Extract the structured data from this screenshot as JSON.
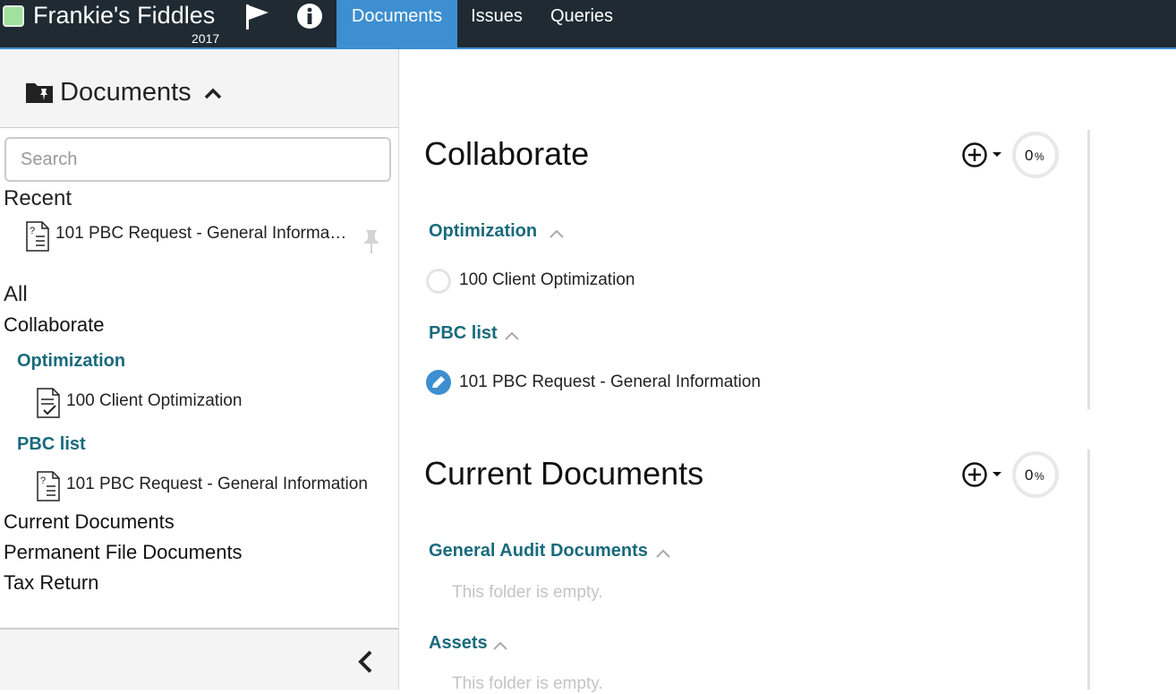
{
  "header": {
    "client_name": "Frankie's Fiddles",
    "year": "2017",
    "tabs": [
      {
        "label": "Documents",
        "active": true
      },
      {
        "label": "Issues",
        "active": false
      },
      {
        "label": "Queries",
        "active": false
      }
    ],
    "icons": {
      "status": "status-square",
      "flag": "flag-icon",
      "info": "info-icon"
    },
    "colors": {
      "bar_bg": "#1f2a33",
      "active_tab": "#3d8fd1",
      "status_green": "#9ee29c"
    }
  },
  "sidebar": {
    "title": "Documents",
    "search_placeholder": "Search",
    "recent_heading": "Recent",
    "recent_items": [
      {
        "label": "101 PBC Request - General Informa…",
        "icon": "doc-question-icon",
        "pin_icon": "pin-icon"
      }
    ],
    "all_heading": "All",
    "collaborate": "Collaborate",
    "groups": [
      {
        "label": "Optimization",
        "docs": [
          {
            "label": "100 Client Optimization",
            "icon": "doc-check-icon"
          }
        ]
      },
      {
        "label": "PBC list",
        "docs": [
          {
            "label": "101 PBC Request - General Information",
            "icon": "doc-question-icon"
          }
        ]
      }
    ],
    "other_sections": [
      "Current Documents",
      "Permanent File Documents",
      "Tax Return"
    ],
    "collapse_icon": "chevron-left-icon"
  },
  "main": {
    "sections": [
      {
        "title": "Collaborate",
        "progress": "0",
        "progress_unit": "%",
        "groups": [
          {
            "label": "Optimization",
            "docs": [
              {
                "label": "100 Client Optimization",
                "status": "not-started"
              }
            ]
          },
          {
            "label": "PBC list",
            "docs": [
              {
                "label": "101 PBC Request - General Information",
                "status": "in-progress"
              }
            ]
          }
        ]
      },
      {
        "title": "Current Documents",
        "progress": "0",
        "progress_unit": "%",
        "groups": [
          {
            "label": "General Audit Documents",
            "empty_text": "This folder is empty."
          },
          {
            "label": "Assets",
            "empty_text": "This folder is empty."
          }
        ]
      }
    ],
    "colors": {
      "group_label": "#196a7c",
      "edit_status": "#3d8fd1",
      "empty_text": "#c4c4c4"
    }
  }
}
